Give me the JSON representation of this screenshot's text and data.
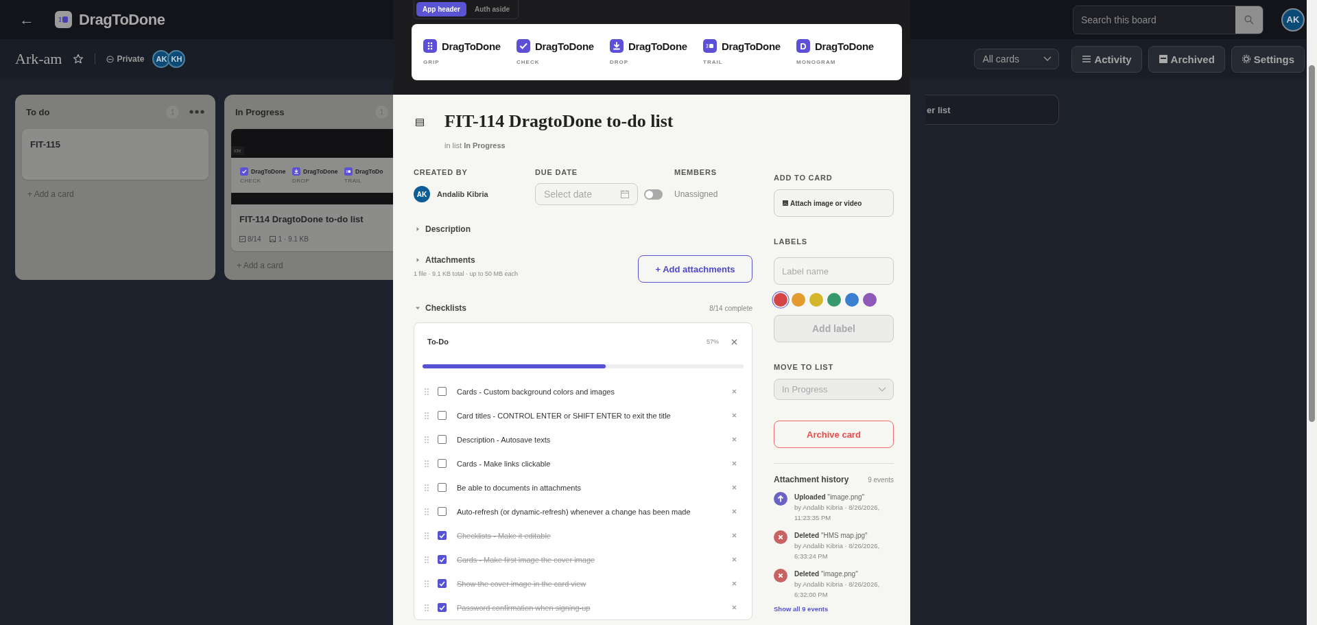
{
  "header": {
    "back": "←",
    "brand": "DragToDone",
    "search": {
      "placeholder": "Search this board"
    },
    "user": "AK"
  },
  "board": {
    "title": "Ark-am",
    "starred": false,
    "visibility": "Private",
    "members": [
      "AK",
      "KH"
    ],
    "filter": "All cards",
    "actions": [
      {
        "kind": "activity",
        "label": "Activity"
      },
      {
        "kind": "archived",
        "label": "Archived"
      },
      {
        "kind": "settings",
        "label": "Settings"
      }
    ]
  },
  "lists": [
    {
      "title": "To do",
      "count": "1",
      "cards": [
        {
          "title": "FIT-115"
        }
      ],
      "add": "+ Add a card"
    },
    {
      "title": "In Progress",
      "count": "1",
      "cards": [
        {
          "title": "FIT-114 DragtoDone to-do list",
          "cover": {
            "tab": "ide",
            "items": [
              {
                "kind": "check",
                "name": "DragToDone",
                "caption": "CHECK"
              },
              {
                "kind": "drop",
                "name": "DragToDone",
                "caption": "DROP"
              },
              {
                "kind": "trail",
                "name": "DragToDo",
                "caption": "TRAIL"
              }
            ]
          },
          "checklist": "8/14",
          "attachments": "1 · 9.1 KB"
        }
      ],
      "add": "+ Add a card"
    }
  ],
  "add_list": "er list",
  "modal": {
    "tabs": [
      {
        "label": "App header",
        "selected": true
      },
      {
        "label": "Auth aside",
        "selected": false
      }
    ],
    "preview": [
      {
        "kind": "grip",
        "name": "DragToDone",
        "caption": "GRIP"
      },
      {
        "kind": "check",
        "name": "DragToDone",
        "caption": "CHECK"
      },
      {
        "kind": "drop",
        "name": "DragToDone",
        "caption": "DROP"
      },
      {
        "kind": "trail",
        "name": "DragToDone",
        "caption": "TRAIL"
      },
      {
        "kind": "monogram",
        "letter": "D",
        "name": "DragToDone",
        "caption": "MONOGRAM"
      }
    ],
    "title": "FIT-114 DragtoDone to-do list",
    "in_list": "in list **In Progress**",
    "created_by": {
      "label": "CREATED BY",
      "avatar": "AK",
      "name": "Andalib Kibria"
    },
    "due_date": {
      "label": "DUE DATE",
      "placeholder": "Select date",
      "on": false
    },
    "members": {
      "label": "MEMBERS",
      "value": "Unassigned"
    },
    "description": {
      "label": "Description",
      "expanded": false
    },
    "attachments": {
      "label": "Attachments",
      "expanded": false,
      "note": "1 file · 9.1 KB total · up to 50 MB each",
      "button": "+ Add attachments"
    },
    "checklists": {
      "label": "Checklists",
      "expanded": true,
      "summary": "8/14 complete",
      "lists": [
        {
          "title": "To-Do",
          "percent": "57%",
          "level": 0.57,
          "items": [
            {
              "text": "Cards - Custom background colors and images",
              "checked": false
            },
            {
              "text": "Card titles - CONTROL ENTER or SHIFT ENTER to exit the title",
              "checked": false
            },
            {
              "text": "Description - Autosave texts",
              "checked": false
            },
            {
              "text": "Cards - Make links clickable",
              "checked": false
            },
            {
              "text": "Be able to documents in attachments",
              "checked": false
            },
            {
              "text": "Auto-refresh (or dynamic-refresh) whenever a change has been made",
              "checked": false
            },
            {
              "text": "Checklists - Make it editable",
              "checked": true
            },
            {
              "text": "Cards - Make first image the cover image",
              "checked": true
            },
            {
              "text": "Show the cover image in the card view",
              "checked": true
            },
            {
              "text": "Password confirmation when signing-up",
              "checked": true
            }
          ]
        }
      ]
    },
    "sidebar": {
      "add_to_card": {
        "label": "ADD TO CARD",
        "button": "Attach image or video"
      },
      "labels": {
        "label": "LABELS",
        "placeholder": "Label name",
        "colors": [
          {
            "color": "#d64545",
            "selected": true
          },
          {
            "color": "#e39a2e",
            "selected": false
          },
          {
            "color": "#d4b62a",
            "selected": false
          },
          {
            "color": "#35996b",
            "selected": false
          },
          {
            "color": "#3b7fcf",
            "selected": false
          },
          {
            "color": "#8e59b8",
            "selected": false
          }
        ],
        "button": "Add label"
      },
      "move": {
        "label": "MOVE TO LIST",
        "value": "In Progress"
      },
      "archive": "Archive card",
      "history": {
        "title": "Attachment history",
        "count": "9 events",
        "events": [
          {
            "kind": "uploaded",
            "text": "**Uploaded** \"image.png\"",
            "meta": "by Andalib Kibria · 8/26/2026, 11:23:35 PM"
          },
          {
            "kind": "deleted",
            "text": "**Deleted** \"HMS map.jpg\"",
            "meta": "by Andalib Kibria · 8/26/2026, 6:33:24 PM"
          },
          {
            "kind": "deleted",
            "text": "**Deleted** \"image.png\"",
            "meta": "by Andalib Kibria · 8/26/2026, 6:32:00 PM"
          }
        ],
        "link": "Show all 9 events"
      }
    }
  }
}
